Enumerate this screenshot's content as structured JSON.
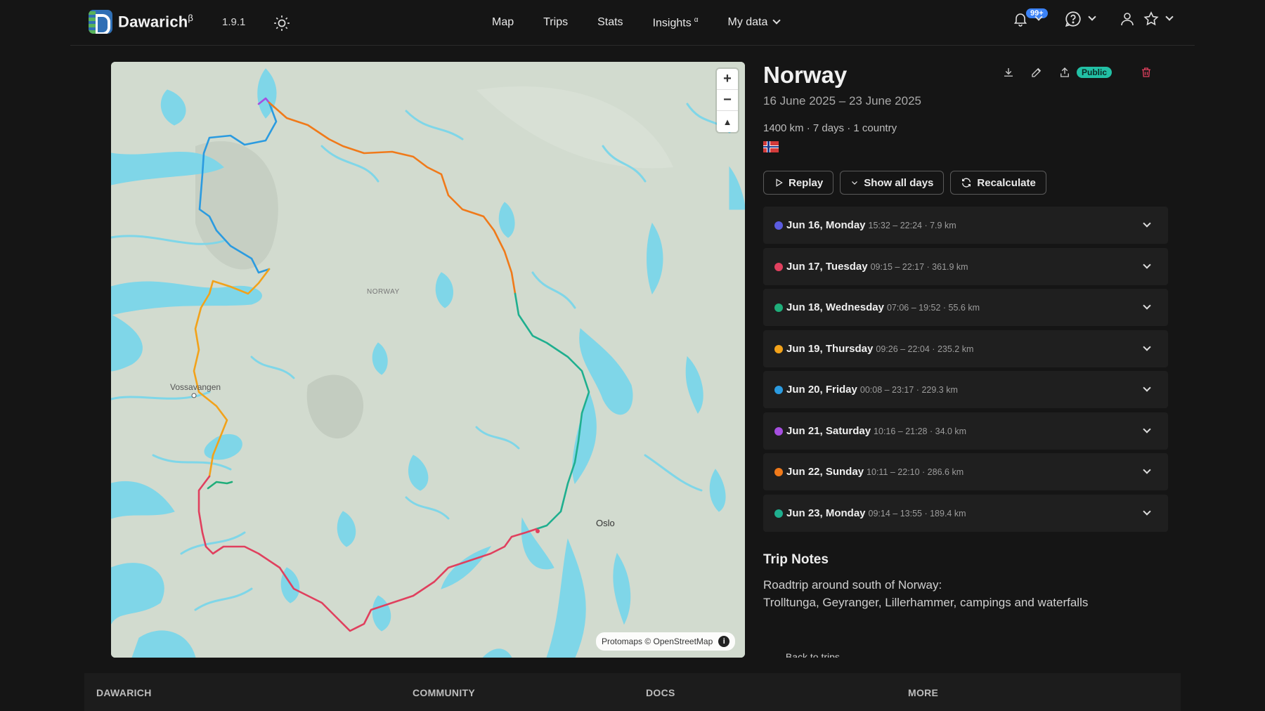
{
  "navbar": {
    "brand": "Dawarich",
    "brand_sup": "β",
    "version": "1.9.1",
    "menu": {
      "map": "Map",
      "trips": "Trips",
      "stats": "Stats",
      "insights": "Insights",
      "insights_sup": "α",
      "my_data": "My data"
    },
    "notifications_badge": "99+"
  },
  "map": {
    "labels": {
      "country": "NORWAY",
      "city1": "Vossavangen",
      "city2": "Oslo"
    },
    "attribution": "Protomaps © OpenStreetMap",
    "info": "i",
    "zoom_in": "+",
    "zoom_out": "−",
    "compass": "▲"
  },
  "trip": {
    "title": "Norway",
    "dates": "16 June 2025 – 23 June 2025",
    "meta": "1400 km · 7 days · 1 country",
    "public_badge": "Public",
    "buttons": {
      "replay": "Replay",
      "show_all_days": "Show all days",
      "recalculate": "Recalculate"
    },
    "days": [
      {
        "name": "Jun 16, Monday",
        "info": "15:32 – 22:24 · 7.9 km",
        "color": "#5b5ce0"
      },
      {
        "name": "Jun 17, Tuesday",
        "info": "09:15 – 22:17 · 361.9 km",
        "color": "#e0405e"
      },
      {
        "name": "Jun 18, Wednesday",
        "info": "07:06 – 19:52 · 55.6 km",
        "color": "#1fae7a"
      },
      {
        "name": "Jun 19, Thursday",
        "info": "09:26 – 22:04 · 235.2 km",
        "color": "#f2a21a"
      },
      {
        "name": "Jun 20, Friday",
        "info": "00:08 – 23:17 · 229.3 km",
        "color": "#2b9be0"
      },
      {
        "name": "Jun 21, Saturday",
        "info": "10:16 – 21:28 · 34.0 km",
        "color": "#a64fe0"
      },
      {
        "name": "Jun 22, Sunday",
        "info": "10:11 – 22:10 · 286.6 km",
        "color": "#f07a1a"
      },
      {
        "name": "Jun 23, Monday",
        "info": "09:14 – 13:55 · 189.4 km",
        "color": "#1faf8f"
      }
    ],
    "notes_title": "Trip Notes",
    "notes_line1": "Roadtrip around south of Norway:",
    "notes_line2": "Trolltunga, Geyranger, Lillerhammer, campings and waterfalls",
    "back_link": "← Back to trips"
  },
  "footer": {
    "col1": "DAWARICH",
    "col2": "COMMUNITY",
    "col3": "DOCS",
    "col4": "MORE"
  }
}
